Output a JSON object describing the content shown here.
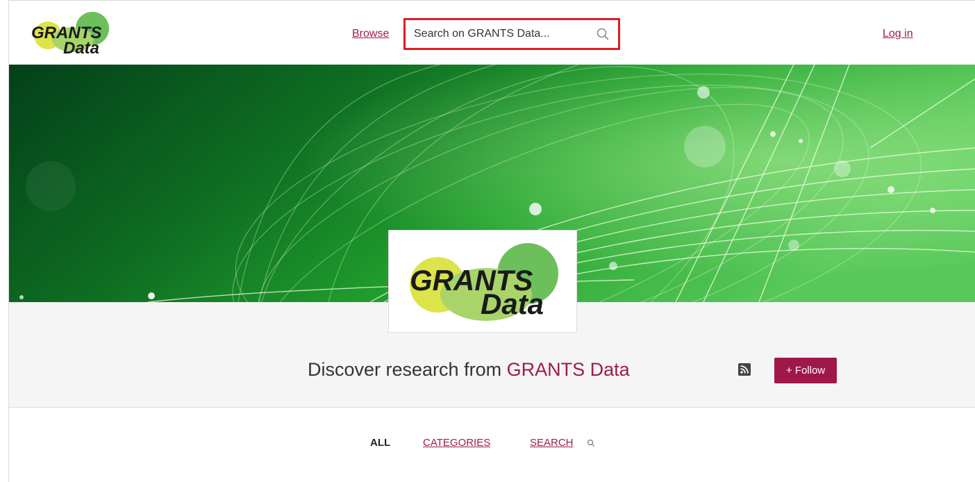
{
  "header": {
    "logo_line1": "GRANTS",
    "logo_line2": "Data",
    "browse_label": "Browse",
    "search_placeholder": "Search on GRANTS Data...",
    "login_label": "Log in"
  },
  "profile": {
    "logo_line1": "GRANTS",
    "logo_line2": "Data",
    "discover_prefix": "Discover research from ",
    "discover_brand": "GRANTS Data",
    "follow_label": "+ Follow"
  },
  "tabs": {
    "all_label": "ALL",
    "categories_label": "CATEGORIES",
    "search_label": "SEARCH"
  },
  "colors": {
    "accent": "#9e1a4d",
    "follow_button": "#a0174a",
    "search_highlight": "#e01b24",
    "banner_green": "#1f9a2e"
  },
  "icons": {
    "search": "search-icon",
    "rss": "rss-icon",
    "tab_search": "search-icon"
  }
}
